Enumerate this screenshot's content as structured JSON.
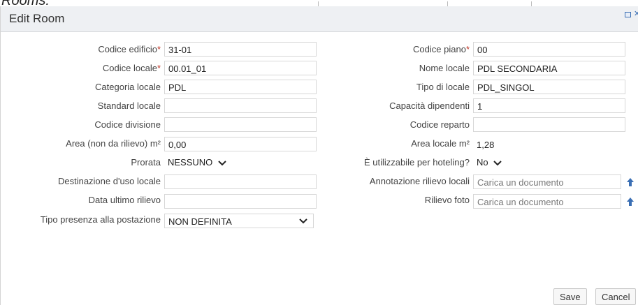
{
  "background": {
    "title": "Rooms:"
  },
  "dialog": {
    "title": "Edit Room",
    "left": [
      {
        "label": "Codice edificio",
        "required": true,
        "value": "31-01",
        "kind": "input"
      },
      {
        "label": "Codice locale",
        "required": true,
        "value": "00.01_01",
        "kind": "input"
      },
      {
        "label": "Categoria locale",
        "required": false,
        "value": "PDL",
        "kind": "input"
      },
      {
        "label": "Standard locale",
        "required": false,
        "value": "",
        "kind": "input"
      },
      {
        "label": "Codice divisione",
        "required": false,
        "value": "",
        "kind": "input"
      },
      {
        "label": "Area (non da rilievo) m²",
        "required": false,
        "value": "0,00",
        "kind": "input"
      },
      {
        "label": "Prorata",
        "required": false,
        "value": "NESSUNO",
        "kind": "select"
      },
      {
        "label": "Destinazione d'uso locale",
        "required": false,
        "value": "",
        "kind": "input"
      },
      {
        "label": "Data ultimo rilievo",
        "required": false,
        "value": "",
        "kind": "input"
      },
      {
        "label": "Tipo presenza alla postazione",
        "required": false,
        "value": "NON DEFINITA",
        "kind": "select"
      }
    ],
    "right": [
      {
        "label": "Codice piano",
        "required": true,
        "value": "00",
        "kind": "input"
      },
      {
        "label": "Nome locale",
        "required": false,
        "value": "PDL SECONDARIA",
        "kind": "input"
      },
      {
        "label": "Tipo di locale",
        "required": false,
        "value": "PDL_SINGOL",
        "kind": "input"
      },
      {
        "label": "Capacità dipendenti",
        "required": false,
        "value": "1",
        "kind": "input"
      },
      {
        "label": "Codice reparto",
        "required": false,
        "value": "",
        "kind": "input"
      },
      {
        "label": "Area locale m²",
        "required": false,
        "value": "1,28",
        "kind": "text"
      },
      {
        "label": "È utilizzabile per hoteling?",
        "required": false,
        "value": "No",
        "kind": "select"
      },
      {
        "label": "Annotazione rilievo locali",
        "required": false,
        "placeholder": "Carica un documento",
        "kind": "upload"
      },
      {
        "label": "Rilievo foto",
        "required": false,
        "placeholder": "Carica un documento",
        "kind": "upload"
      }
    ],
    "buttons": {
      "save": "Save",
      "cancel": "Cancel"
    },
    "colors": {
      "required_star": "#c0392b",
      "upload_icon": "#3b6fb4",
      "header_bg": "#eef0f3"
    }
  }
}
